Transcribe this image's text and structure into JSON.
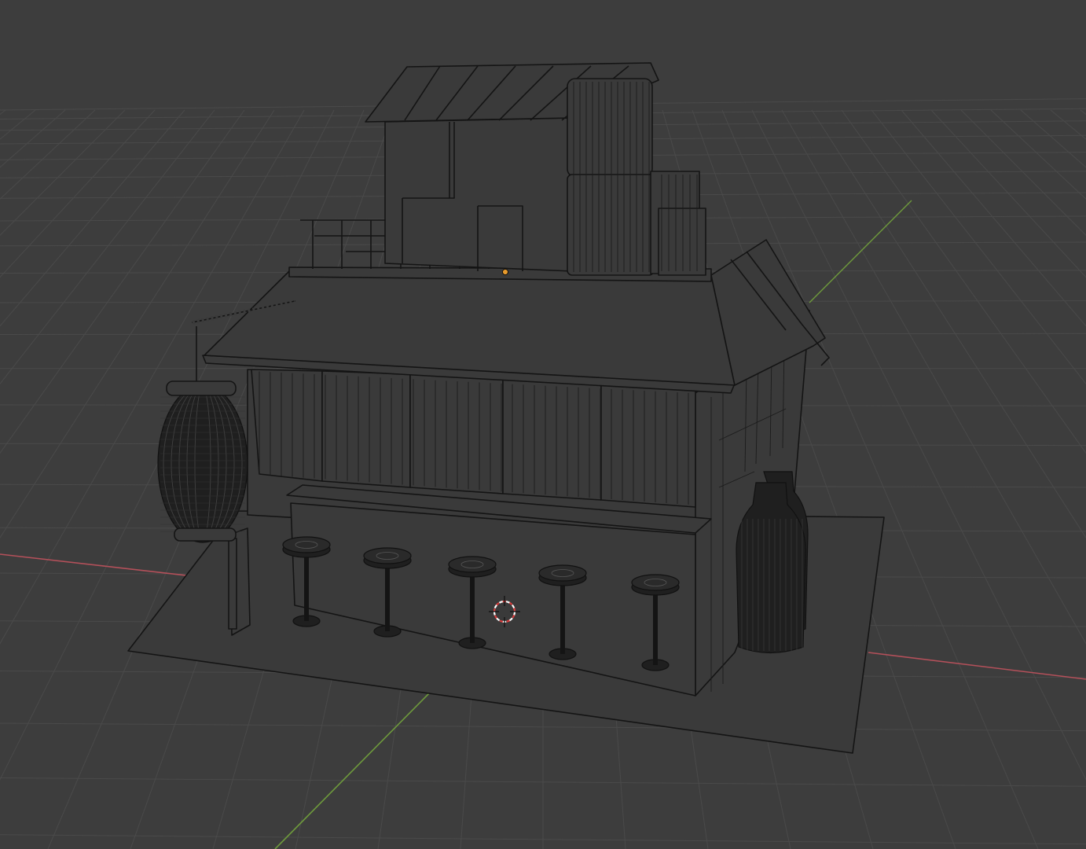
{
  "app": "3D viewport",
  "viewport": {
    "shading": "wireframe",
    "background_color": "#3d3d3d",
    "grid_color": "#4a4a4a",
    "x_axis_color": "#b4505a",
    "y_axis_color": "#6e9a3c",
    "wire_color": "#141414",
    "origin_dot_color": "#e79a2c",
    "cursor_colors": [
      "#d83b3b",
      "#ffffff"
    ]
  },
  "scene_objects": [
    {
      "name": "ground-plane"
    },
    {
      "name": "shop-building"
    },
    {
      "name": "roof"
    },
    {
      "name": "rooftop-railing"
    },
    {
      "name": "upper-cabin"
    },
    {
      "name": "water-tank"
    },
    {
      "name": "hanging-lantern"
    },
    {
      "name": "lantern-pole"
    },
    {
      "name": "counter"
    },
    {
      "name": "bar-stool",
      "count": 5
    },
    {
      "name": "sake-jars",
      "count": 2
    }
  ],
  "icons": {
    "origin": "object-origin-icon",
    "cursor": "3d-cursor-icon"
  }
}
